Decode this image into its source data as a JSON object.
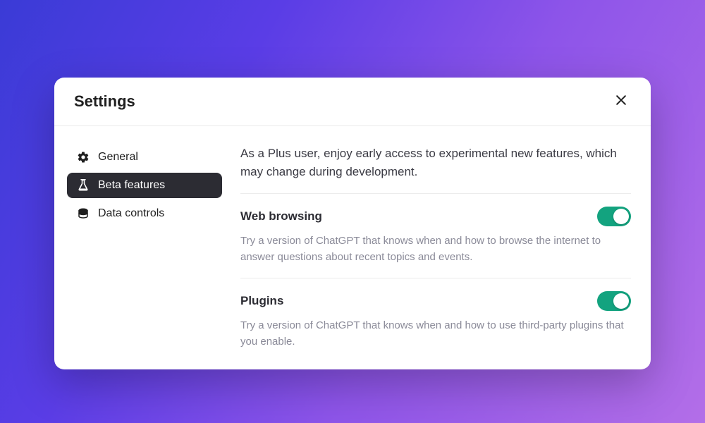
{
  "modal": {
    "title": "Settings"
  },
  "sidebar": {
    "items": [
      {
        "label": "General"
      },
      {
        "label": "Beta features"
      },
      {
        "label": "Data controls"
      }
    ]
  },
  "content": {
    "intro": "As a Plus user, enjoy early access to experimental new features, which may change during development.",
    "sections": [
      {
        "title": "Web browsing",
        "desc": "Try a version of ChatGPT that knows when and how to browse the internet to answer questions about recent topics and events.",
        "enabled": true
      },
      {
        "title": "Plugins",
        "desc": "Try a version of ChatGPT that knows when and how to use third-party plugins that you enable.",
        "enabled": true
      }
    ]
  }
}
